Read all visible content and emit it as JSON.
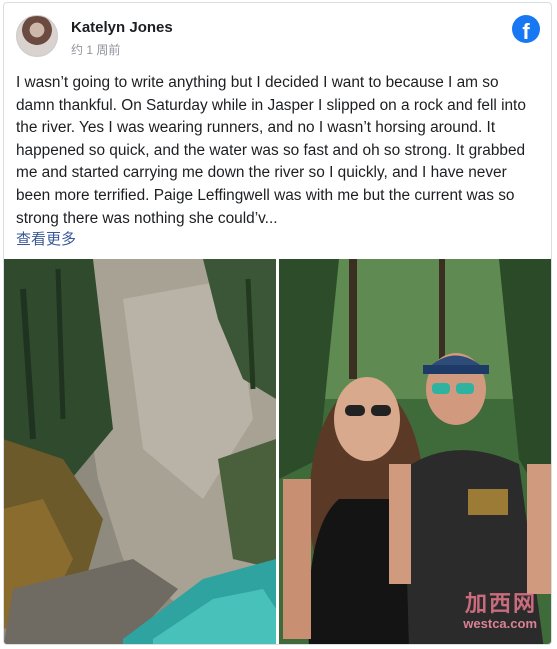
{
  "post": {
    "author": "Katelyn Jones",
    "timestamp": "约 1 周前",
    "brand_logo": "f",
    "body": "I wasn’t going to write anything but I decided I want to because I am so damn thankful. On Saturday while in Jasper I slipped on a rock and fell into the river. Yes I was wearing runners, and no I wasn’t horsing around. It happened so quick, and the water was so fast and oh so strong. It grabbed me and started carrying me down the river so I quickly, and I have never been more terrified. Paige Leffingwell was with me but the current was so strong there was nothing she could’v...",
    "see_more": "查看更多"
  },
  "watermark": {
    "cn": "加西网",
    "en": "westca.com"
  },
  "colors": {
    "link": "#385898",
    "brand": "#1877f2",
    "text": "#1c1e21",
    "meta": "#90949c"
  },
  "icons": [
    "facebook-logo-icon"
  ]
}
